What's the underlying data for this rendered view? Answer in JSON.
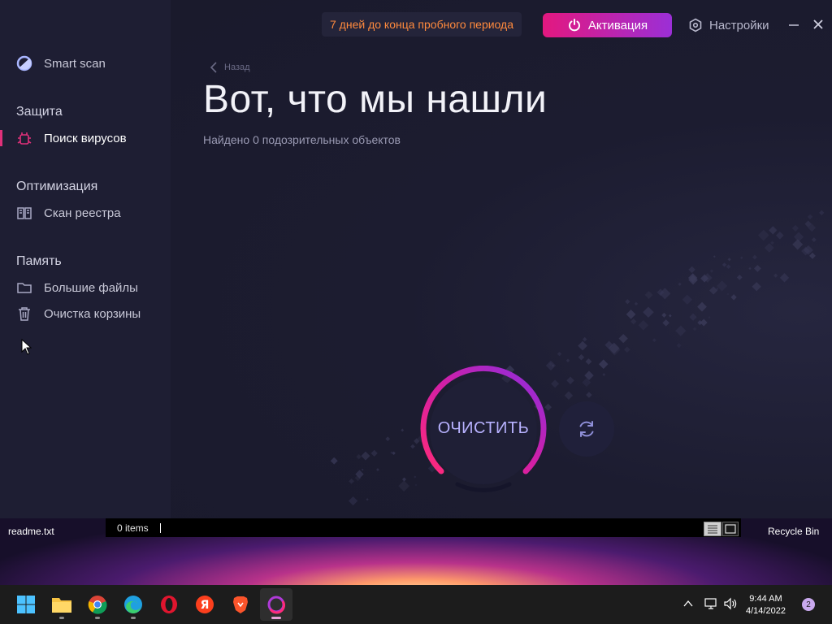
{
  "sidebar": {
    "smart_scan": "Smart scan",
    "sections": [
      {
        "title": "Защита",
        "items": [
          {
            "label": "Поиск вирусов",
            "icon": "bug-icon",
            "active": true
          }
        ]
      },
      {
        "title": "Оптимизация",
        "items": [
          {
            "label": "Скан реестра",
            "icon": "registry-book-icon"
          }
        ]
      },
      {
        "title": "Память",
        "items": [
          {
            "label": "Большие файлы",
            "icon": "folder-icon"
          },
          {
            "label": "Очистка корзины",
            "icon": "trash-icon"
          }
        ]
      }
    ]
  },
  "topbar": {
    "trial_text": "7 дней до конца пробного периода",
    "activate_label": "Активация",
    "settings_label": "Настройки"
  },
  "main": {
    "back_label": "Назад",
    "title": "Вот, что мы нашли",
    "subtitle": "Найдено 0 подозрительных объектов",
    "clean_label": "ОЧИСТИТЬ"
  },
  "explorer": {
    "left_file": "readme.txt",
    "status": "0 items",
    "right_label": "Recycle Bin"
  },
  "taskbar": {
    "apps": [
      "start",
      "file-explorer",
      "chrome",
      "edge",
      "opera",
      "yandex",
      "brave",
      "cleaner-app"
    ],
    "time": "9:44 AM",
    "date": "4/14/2022",
    "notifications": "2"
  },
  "colors": {
    "accent_pink": "#e3187f",
    "accent_purple": "#9b2fd6",
    "trial_orange": "#ff8a3d"
  }
}
